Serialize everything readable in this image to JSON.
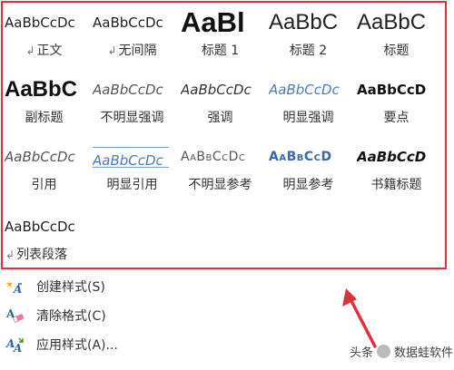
{
  "styles_gallery": {
    "rows": [
      [
        {
          "preview": "AaBbCcDc",
          "label": "正文",
          "mark": "↲",
          "style": "normal"
        },
        {
          "preview": "AaBbCcDc",
          "label": "无间隔",
          "mark": "↲",
          "style": "normal"
        },
        {
          "preview": "AaBl",
          "label": "标题 1",
          "mark": "",
          "style": "h1"
        },
        {
          "preview": "AaBbC",
          "label": "标题 2",
          "mark": "",
          "style": "h2"
        },
        {
          "preview": "AaBbC",
          "label": "标题",
          "mark": "",
          "style": "head"
        }
      ],
      [
        {
          "preview": "AaBbC",
          "label": "副标题",
          "mark": "",
          "style": "sub"
        },
        {
          "preview": "AaBbCcDc",
          "label": "不明显强调",
          "mark": "",
          "style": "subtle"
        },
        {
          "preview": "AaBbCcDc",
          "label": "强调",
          "mark": "",
          "style": "emph"
        },
        {
          "preview": "AaBbCcDc",
          "label": "明显强调",
          "mark": "",
          "style": "intense"
        },
        {
          "preview": "AaBbCcD",
          "label": "要点",
          "mark": "",
          "style": "strong"
        }
      ],
      [
        {
          "preview": "AaBbCcDc",
          "label": "引用",
          "mark": "",
          "style": "quote"
        },
        {
          "preview": "AaBbCcDc",
          "label": "明显引用",
          "mark": "",
          "style": "iquote"
        },
        {
          "preview": "AaBbCcDc",
          "label": "不明显参考",
          "mark": "",
          "style": "sref"
        },
        {
          "preview": "AaBbCcD",
          "label": "明显参考",
          "mark": "",
          "style": "iref"
        },
        {
          "preview": "AaBbCcD",
          "label": "书籍标题",
          "mark": "",
          "style": "book"
        }
      ],
      [
        {
          "preview": "AaBbCcDc",
          "label": "列表段落",
          "mark": "↲",
          "style": "list"
        }
      ]
    ]
  },
  "menu": {
    "create_style": "创建样式(S)",
    "clear_format": "清除格式(C)",
    "apply_style": "应用样式(A)..."
  },
  "watermark": {
    "prefix": "头条",
    "name": "数据蛙软件"
  },
  "colors": {
    "highlight_border": "#e0303a",
    "annotation_arrow": "#e0303a"
  }
}
